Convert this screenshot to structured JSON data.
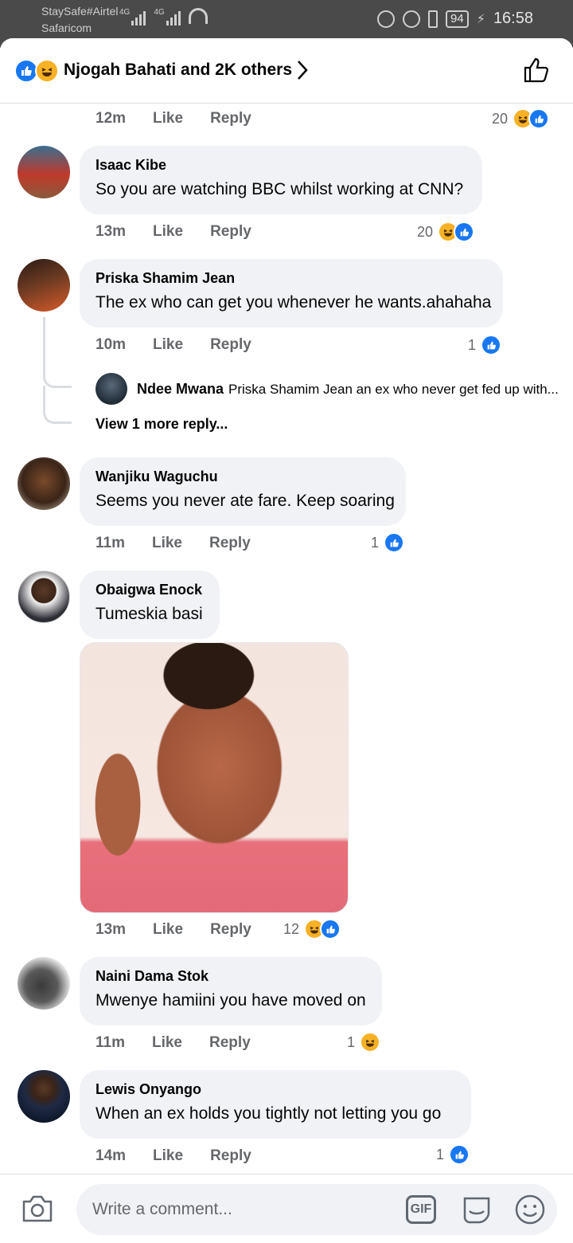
{
  "status_bar": {
    "carrier_top": "StaySafe#Airtel",
    "carrier_bottom": "Safaricom",
    "network1": "4G",
    "network2": "4G",
    "battery": "94",
    "time": "16:58"
  },
  "header": {
    "reactions_text": "Njogah Bahati and 2K others"
  },
  "comments": [
    {
      "time": "12m",
      "like": "Like",
      "reply": "Reply",
      "count": "20"
    },
    {
      "author": "Isaac Kibe",
      "text": "So you are watching BBC whilst working at CNN?",
      "time": "13m",
      "like": "Like",
      "reply": "Reply",
      "count": "20"
    },
    {
      "author": "Priska Shamim Jean",
      "text": "The ex who can get you whenever he wants.ahahaha",
      "time": "10m",
      "like": "Like",
      "reply": "Reply",
      "count": "1"
    },
    {
      "author": "Wanjiku Waguchu",
      "text": "Seems you never ate fare. Keep soaring",
      "time": "11m",
      "like": "Like",
      "reply": "Reply",
      "count": "1"
    },
    {
      "author": "Obaigwa Enock",
      "text": "Tumeskia basi",
      "time": "13m",
      "like": "Like",
      "reply": "Reply",
      "count": "12"
    },
    {
      "author": "Naini Dama Stok",
      "text": "Mwenye hamiini you have moved on",
      "time": "11m",
      "like": "Like",
      "reply": "Reply",
      "count": "1"
    },
    {
      "author": "Lewis Onyango",
      "text": "When an ex holds you tightly not letting you go",
      "time": "14m",
      "like": "Like",
      "reply": "Reply",
      "count": "1"
    }
  ],
  "reply_preview": {
    "author": "Ndee Mwana",
    "text": "Priska Shamim Jean an ex who never get fed up with...",
    "view_more": "View 1 more reply..."
  },
  "composer": {
    "placeholder": "Write a comment...",
    "gif_label": "GIF"
  },
  "colors": {
    "like_blue": "#1877f2",
    "haha_yellow": "#f7b125",
    "bubble_bg": "#f0f2f5",
    "meta_gray": "#65676b"
  }
}
